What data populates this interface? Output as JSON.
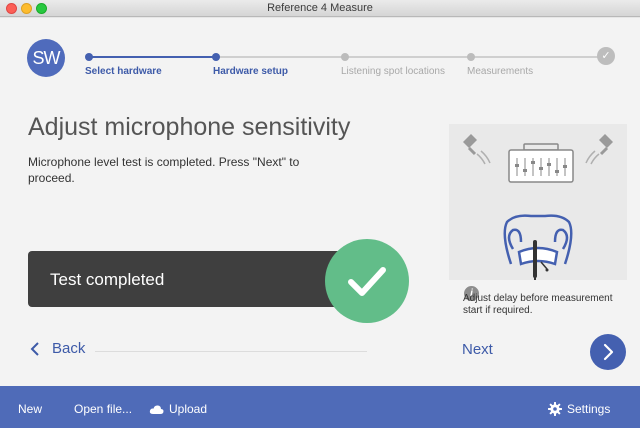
{
  "window": {
    "title": "Reference 4 Measure"
  },
  "logo": {
    "text": "SW"
  },
  "steps": [
    {
      "label": "Select hardware",
      "state": "active"
    },
    {
      "label": "Hardware setup",
      "state": "active"
    },
    {
      "label": "Listening spot locations",
      "state": "inactive"
    },
    {
      "label": "Measurements",
      "state": "inactive"
    }
  ],
  "main": {
    "heading": "Adjust microphone sensitivity",
    "description": "Microphone level test is completed. Press \"Next\" to proceed.",
    "result_label": "Test completed"
  },
  "side": {
    "info_text": "Adjust delay before measurement start if required."
  },
  "nav": {
    "back_label": "Back",
    "next_label": "Next"
  },
  "bottombar": {
    "new_label": "New",
    "open_label": "Open file...",
    "upload_label": "Upload",
    "settings_label": "Settings"
  },
  "colors": {
    "accent": "#4460b0",
    "success": "#62bd89",
    "bottom_bar": "#4f6bb8"
  }
}
